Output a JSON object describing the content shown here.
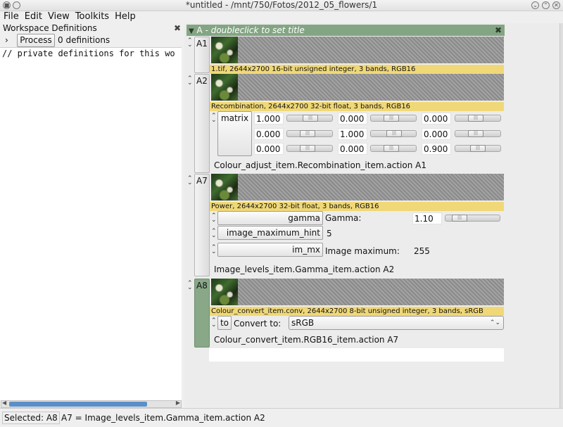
{
  "window": {
    "title": "*untitled - /mnt/750/Fotos/2012_05_flowers/1"
  },
  "menu": [
    "File",
    "Edit",
    "View",
    "Toolkits",
    "Help"
  ],
  "workspace": {
    "title": "Workspace Definitions",
    "process_label": "Process",
    "count": "0 definitions",
    "text": "// private definitions for this wo"
  },
  "column": {
    "name": "A",
    "hint": "doubleclick to set title"
  },
  "rows": {
    "a1": {
      "label": "A1",
      "caption": "1.tif, 2644x2700 16-bit unsigned integer, 3 bands, RGB16"
    },
    "a2": {
      "label": "A2",
      "caption": "Recombination, 2644x2700 32-bit float, 3 bands, RGB16",
      "matrix_label": "matrix",
      "matrix": [
        "1.000",
        "0.000",
        "0.000",
        "0.000",
        "1.000",
        "0.000",
        "0.000",
        "0.000",
        "0.900"
      ],
      "matrix_levels": [
        0.5,
        0.4,
        0.4,
        0.4,
        0.5,
        0.4,
        0.4,
        0.4,
        0.47
      ],
      "action": "Colour_adjust_item.Recombination_item.action A1"
    },
    "a7": {
      "label": "A7",
      "caption": "Power, 2644x2700 32-bit float, 3 bands, RGB16",
      "gamma_button": "gamma",
      "gamma_label": "Gamma:",
      "gamma_value": "1.10",
      "gamma_level": 0.15,
      "hint_button": "image_maximum_hint",
      "hint_value": "5",
      "max_button": "im_mx",
      "max_label": "Image maximum:",
      "max_value": "255",
      "action": "Image_levels_item.Gamma_item.action A2"
    },
    "a8": {
      "label": "A8",
      "caption": "Colour_convert_item.conv, 2644x2700 8-bit unsigned integer, 3 bands, sRGB",
      "to_button": "to",
      "convert_label": "Convert to:",
      "convert_value": "sRGB",
      "action": "Colour_convert_item.RGB16_item.action A7"
    }
  },
  "status": {
    "selected": "Selected: A8",
    "action": "A7 = Image_levels_item.Gamma_item.action A2"
  },
  "colors": {
    "column_header": "#83a583",
    "caption": "#f0d878",
    "selected_row": "#88a888",
    "scroll_thumb": "#5b8fc9"
  }
}
